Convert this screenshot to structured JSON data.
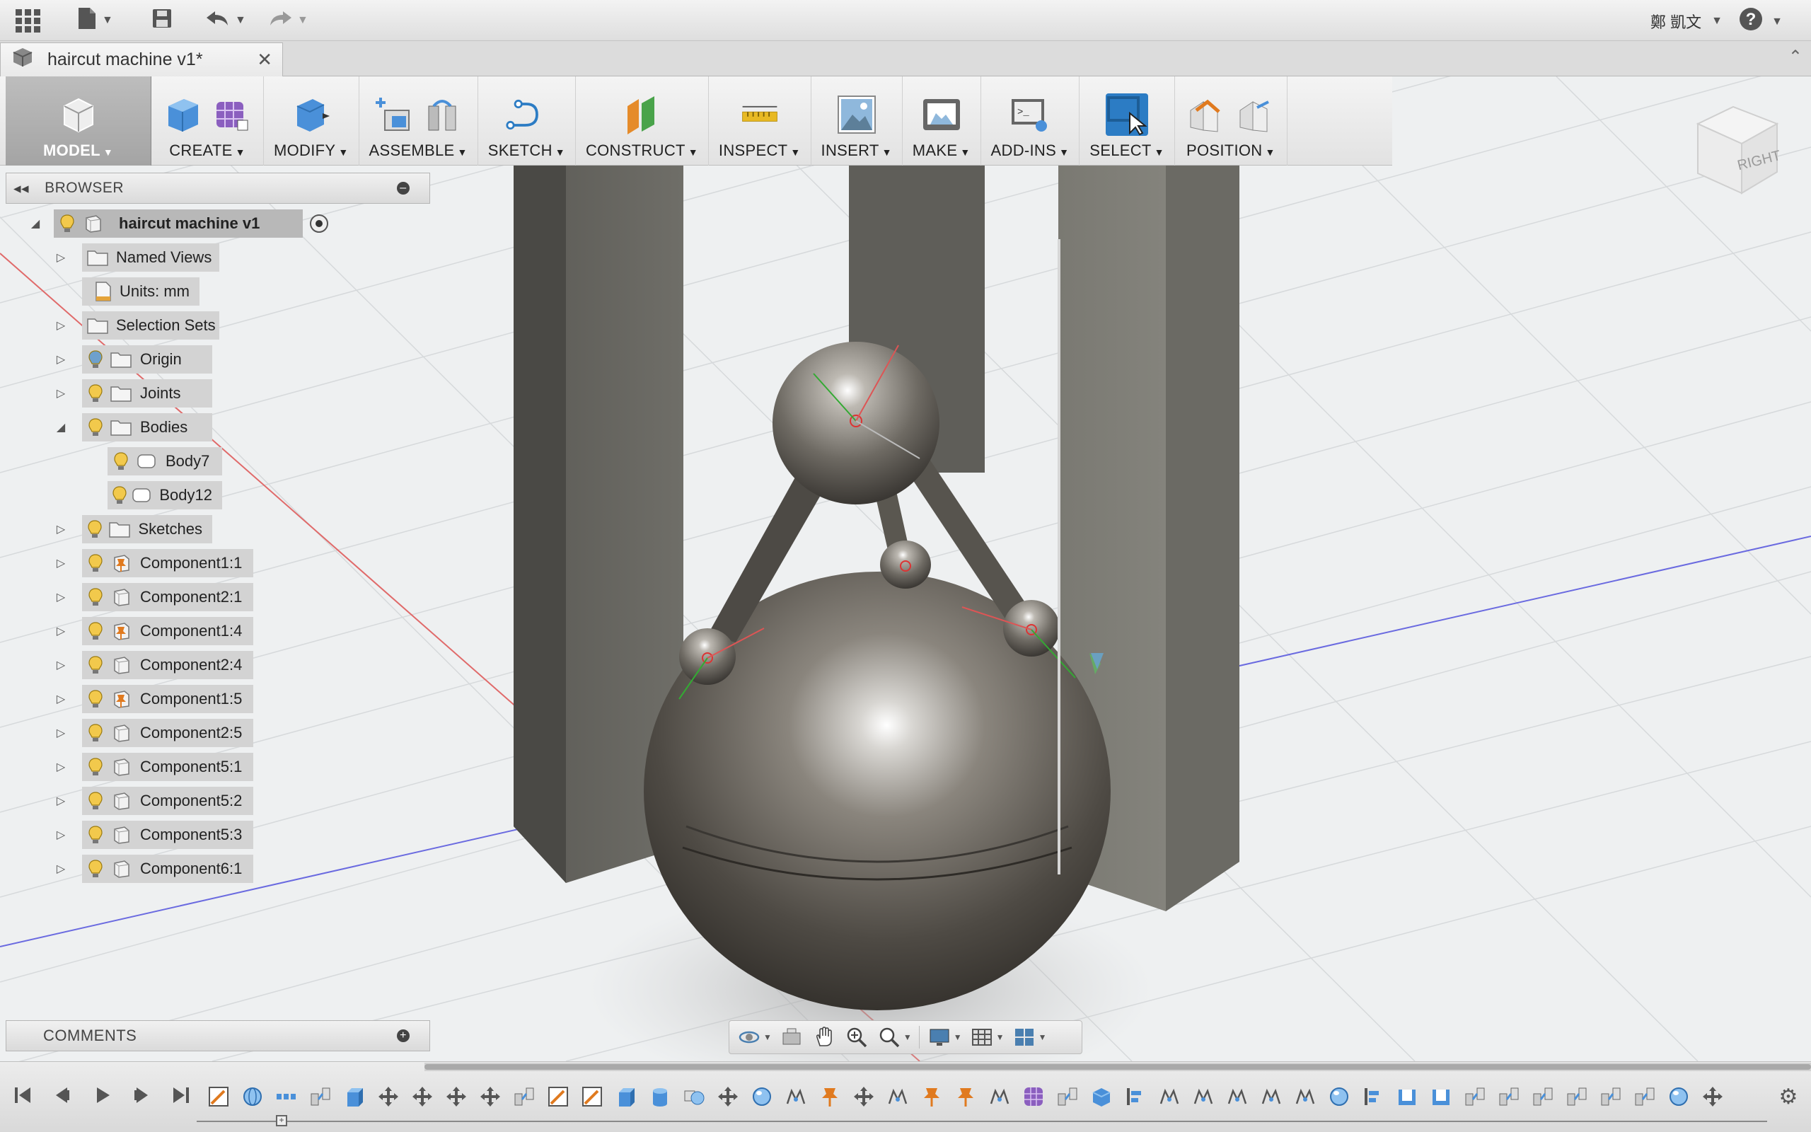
{
  "app": {
    "document_tab": "haircut machine v1*",
    "user_name": "鄭 凱文"
  },
  "toolbar": {
    "groups": [
      {
        "id": "model",
        "label": "MODEL",
        "icons": [
          "model-workspace-icon"
        ]
      },
      {
        "id": "create",
        "label": "CREATE",
        "icons": [
          "box-icon",
          "form-icon"
        ]
      },
      {
        "id": "modify",
        "label": "MODIFY",
        "icons": [
          "press-pull-icon"
        ]
      },
      {
        "id": "assemble",
        "label": "ASSEMBLE",
        "icons": [
          "new-component-icon",
          "joint-icon"
        ]
      },
      {
        "id": "sketch",
        "label": "SKETCH",
        "icons": [
          "sketch-icon"
        ]
      },
      {
        "id": "construct",
        "label": "CONSTRUCT",
        "icons": [
          "offset-plane-icon"
        ]
      },
      {
        "id": "inspect",
        "label": "INSPECT",
        "icons": [
          "measure-icon"
        ]
      },
      {
        "id": "insert",
        "label": "INSERT",
        "icons": [
          "insert-image-icon"
        ]
      },
      {
        "id": "make",
        "label": "MAKE",
        "icons": [
          "3d-print-icon"
        ]
      },
      {
        "id": "add-ins",
        "label": "ADD-INS",
        "icons": [
          "scripts-icon"
        ]
      },
      {
        "id": "select",
        "label": "SELECT",
        "icons": [
          "select-icon"
        ]
      },
      {
        "id": "position",
        "label": "POSITION",
        "icons": [
          "capture-position-icon",
          "revert-position-icon"
        ]
      }
    ]
  },
  "viewcube": {
    "face": "RIGHT"
  },
  "browser": {
    "title": "BROWSER",
    "root": "haircut machine v1",
    "items": [
      {
        "label": "Named Views",
        "icon": "folder",
        "bulb": false,
        "expand": "collapsed",
        "indent": 0
      },
      {
        "label": "Units: mm",
        "icon": "document",
        "bulb": false,
        "expand": "none",
        "indent": 0
      },
      {
        "label": "Selection Sets",
        "icon": "folder",
        "bulb": false,
        "expand": "collapsed",
        "indent": 0
      },
      {
        "label": "Origin",
        "icon": "folder",
        "bulb": true,
        "bulb_color": "#6ea0cc",
        "expand": "collapsed",
        "indent": 0
      },
      {
        "label": "Joints",
        "icon": "folder",
        "bulb": true,
        "expand": "collapsed",
        "indent": 0
      },
      {
        "label": "Bodies",
        "icon": "folder",
        "bulb": true,
        "expand": "expanded",
        "indent": 0
      },
      {
        "label": "Body7",
        "icon": "body",
        "bulb": true,
        "expand": "none",
        "indent": 1
      },
      {
        "label": "Body12",
        "icon": "body",
        "bulb": true,
        "expand": "none",
        "indent": 1
      },
      {
        "label": "Sketches",
        "icon": "folder",
        "bulb": true,
        "expand": "collapsed",
        "indent": 0
      },
      {
        "label": "Component1:1",
        "icon": "component-pinned",
        "bulb": true,
        "expand": "collapsed",
        "indent": 0
      },
      {
        "label": "Component2:1",
        "icon": "component",
        "bulb": true,
        "expand": "collapsed",
        "indent": 0
      },
      {
        "label": "Component1:4",
        "icon": "component-pinned",
        "bulb": true,
        "expand": "collapsed",
        "indent": 0
      },
      {
        "label": "Component2:4",
        "icon": "component",
        "bulb": true,
        "expand": "collapsed",
        "indent": 0
      },
      {
        "label": "Component1:5",
        "icon": "component-pinned",
        "bulb": true,
        "expand": "collapsed",
        "indent": 0
      },
      {
        "label": "Component2:5",
        "icon": "component",
        "bulb": true,
        "expand": "collapsed",
        "indent": 0
      },
      {
        "label": "Component5:1",
        "icon": "component",
        "bulb": true,
        "expand": "collapsed",
        "indent": 0
      },
      {
        "label": "Component5:2",
        "icon": "component",
        "bulb": true,
        "expand": "collapsed",
        "indent": 0
      },
      {
        "label": "Component5:3",
        "icon": "component",
        "bulb": true,
        "expand": "collapsed",
        "indent": 0
      },
      {
        "label": "Component6:1",
        "icon": "component",
        "bulb": true,
        "expand": "collapsed",
        "indent": 0
      }
    ]
  },
  "comments": {
    "title": "COMMENTS"
  },
  "navbar": {
    "icons": [
      "orbit-icon",
      "look-at-icon",
      "pan-icon",
      "zoom-icon",
      "fit-icon",
      "display-settings-icon",
      "grid-settings-icon",
      "viewports-icon"
    ]
  },
  "timeline": {
    "controls": [
      "go-to-start-icon",
      "step-back-icon",
      "play-icon",
      "step-forward-icon",
      "go-to-end-icon"
    ],
    "features": [
      "sketch",
      "revolve",
      "pattern",
      "joint",
      "extrude",
      "move",
      "move",
      "move",
      "move",
      "joint",
      "sketch",
      "sketch",
      "extrude",
      "cylinder",
      "combine",
      "move",
      "sphere",
      "rigid",
      "pin",
      "move",
      "rigid",
      "pin",
      "pin",
      "rigid",
      "form",
      "joint",
      "box",
      "align",
      "rigid",
      "rigid",
      "rigid",
      "rigid",
      "rigid",
      "sphere",
      "align",
      "shell",
      "shell",
      "joint",
      "joint",
      "joint",
      "joint",
      "joint",
      "joint",
      "sphere",
      "move"
    ]
  },
  "colors": {
    "accent_blue": "#2c7cc4",
    "bulb_yellow": "#f2c94c",
    "pin_orange": "#e07a1f"
  }
}
